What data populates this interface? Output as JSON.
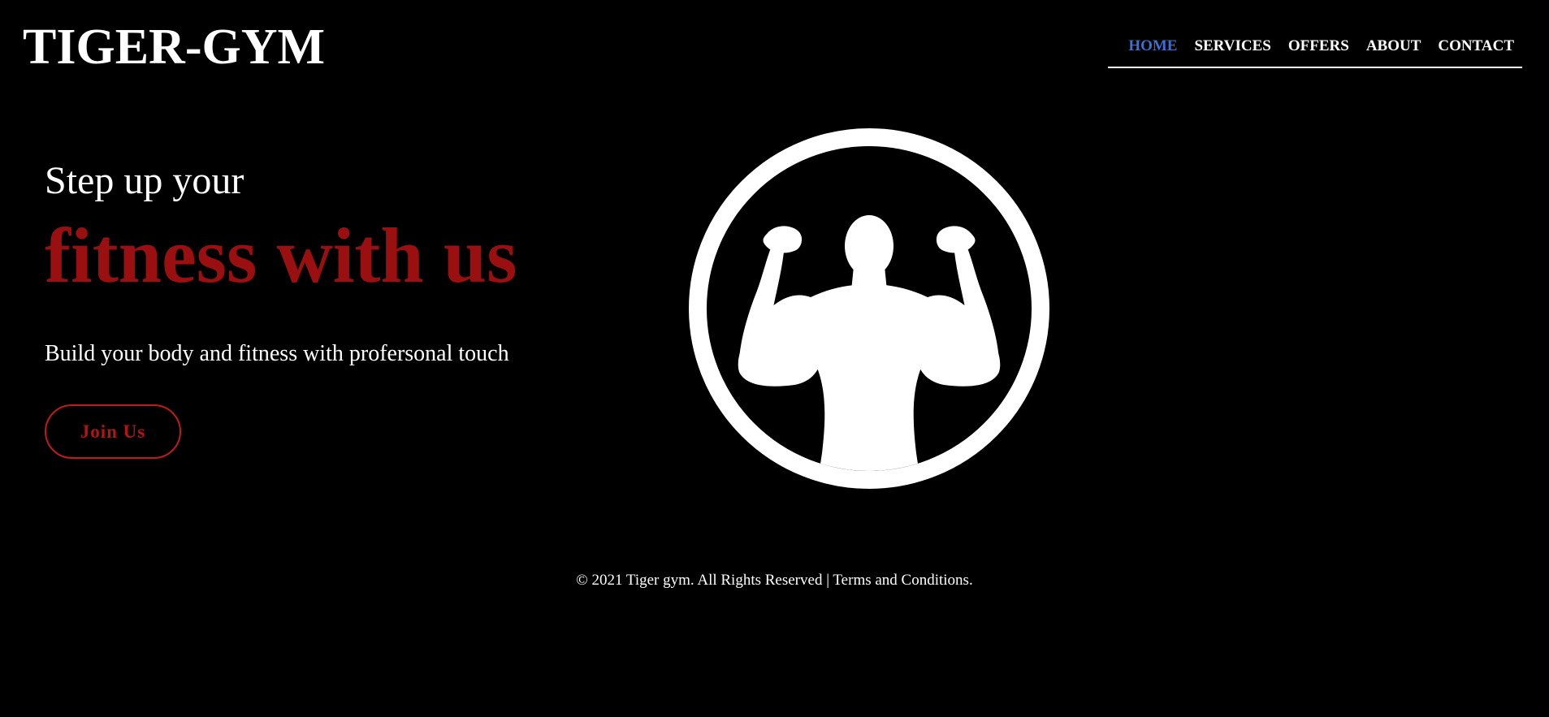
{
  "header": {
    "logo": "TIGER-GYM",
    "nav": [
      {
        "label": "HOME",
        "active": true
      },
      {
        "label": "SERVICES",
        "active": false
      },
      {
        "label": "OFFERS",
        "active": false
      },
      {
        "label": "ABOUT",
        "active": false
      },
      {
        "label": "CONTACT",
        "active": false
      }
    ]
  },
  "hero": {
    "line1": "Step up your",
    "line2": "fitness with us",
    "subtitle": "Build your body and fitness with profersonal touch",
    "cta_label": "Join Us",
    "emblem_icon": "flexing-man-icon"
  },
  "footer": {
    "text": "© 2021 Tiger gym. All Rights Reserved | Terms and Conditions."
  },
  "colors": {
    "background": "#000000",
    "accent_red": "#9a0f0f",
    "active_nav": "#3c6fd8",
    "text": "#ffffff"
  }
}
